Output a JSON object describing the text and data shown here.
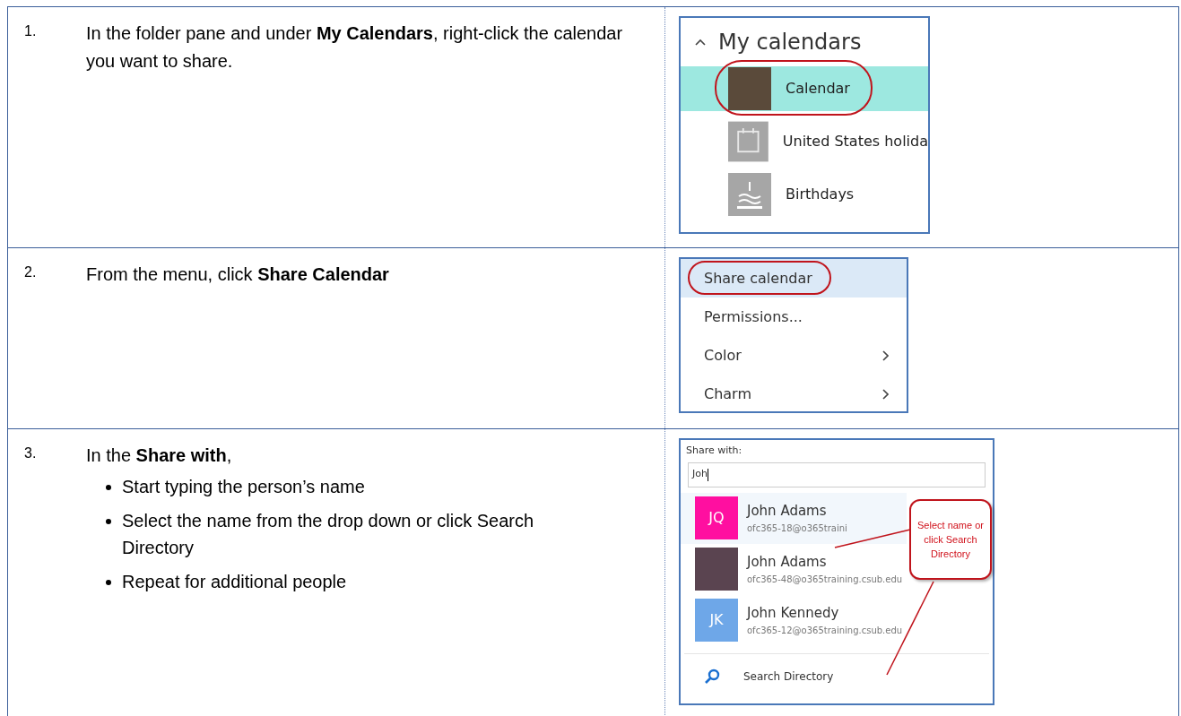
{
  "steps": [
    {
      "number": "1.",
      "instruction": "In the folder pane and under **My Calendars**, right-click the calendar you want to share.",
      "screenshot": {
        "kind": "calendars",
        "header": "My calendars",
        "items": [
          {
            "label": "Calendar",
            "kind": "photo",
            "selected": true
          },
          {
            "label": "United States holida",
            "kind": "calendar",
            "selected": false
          },
          {
            "label": "Birthdays",
            "kind": "cake",
            "selected": false
          }
        ]
      }
    },
    {
      "number": "2.",
      "instruction": "From the menu, click **Share Calendar**",
      "screenshot": {
        "kind": "menu",
        "items": [
          {
            "label": "Share calendar",
            "selected": true,
            "submenu": false
          },
          {
            "label": "Permissions...",
            "selected": false,
            "submenu": false
          },
          {
            "label": "Color",
            "selected": false,
            "submenu": true
          },
          {
            "label": "Charm",
            "selected": false,
            "submenu": true
          }
        ]
      }
    },
    {
      "number": "3.",
      "instruction": "In the **Share with**,",
      "bullets": [
        "Start typing the person’s name",
        "Select the name from the drop down or click Search Directory",
        "Repeat for additional people"
      ],
      "screenshot": {
        "kind": "share",
        "label": "Share with:",
        "value": "Joh",
        "suggestions": [
          {
            "kind": "initials",
            "initials": "JQ",
            "color": "#ff0fa0",
            "name": "John Adams",
            "email": "ofc365-18@o365traini",
            "selected": true
          },
          {
            "kind": "photo",
            "name": "John Adams",
            "email": "ofc365-48@o365training.csub.edu",
            "selected": false
          },
          {
            "kind": "initials",
            "initials": "JK",
            "color": "#6ea7e8",
            "name": "John Kennedy",
            "email": "ofc365-12@o365training.csub.edu",
            "selected": false
          }
        ],
        "search": "Search Directory",
        "callout": "Select name or click Search Directory"
      }
    }
  ]
}
